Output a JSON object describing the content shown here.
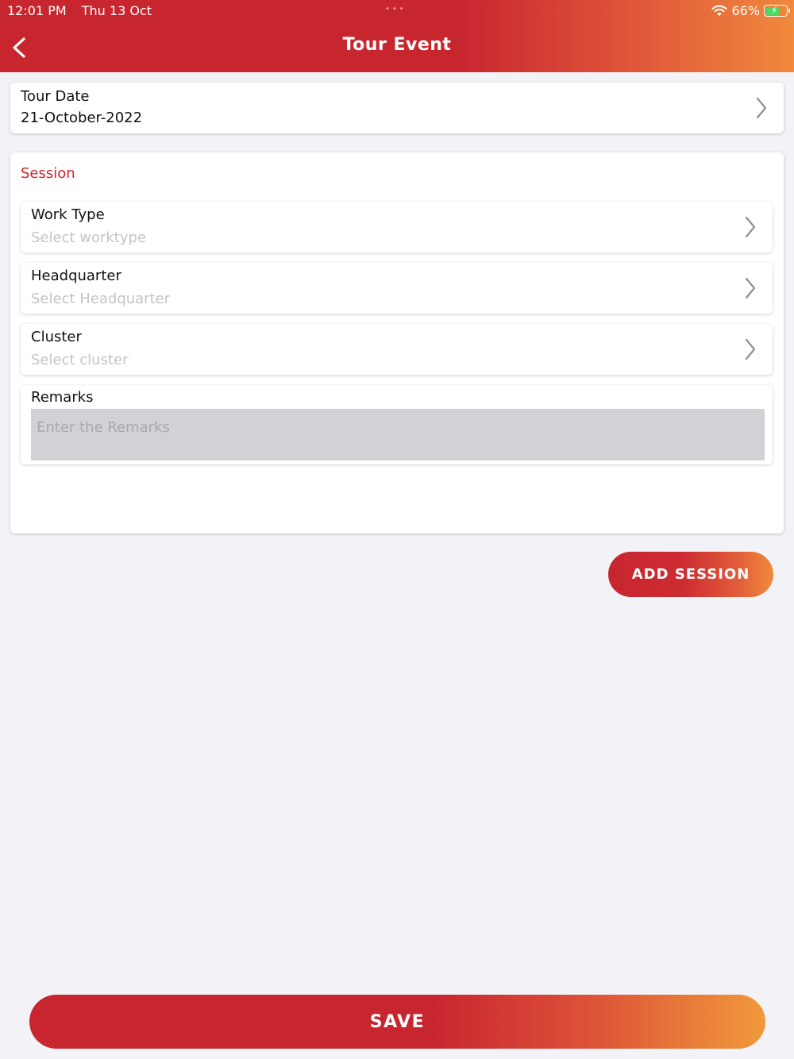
{
  "status_bar": {
    "time": "12:01 PM",
    "date": "Thu 13 Oct",
    "dots": "•••",
    "battery_percent": "66%",
    "wifi_icon": "wifi-icon",
    "battery_icon": "battery-charging-icon",
    "battery_level": 0.66
  },
  "header": {
    "title": "Tour Event",
    "back_icon": "chevron-left-icon"
  },
  "tour_date": {
    "label": "Tour Date",
    "value": "21-October-2022"
  },
  "session": {
    "title": "Session",
    "work_type": {
      "label": "Work Type",
      "placeholder": "Select worktype"
    },
    "headquarter": {
      "label": "Headquarter",
      "placeholder": "Select Headquarter"
    },
    "cluster": {
      "label": "Cluster",
      "placeholder": "Select cluster"
    },
    "remarks": {
      "label": "Remarks",
      "placeholder": "Enter the Remarks"
    }
  },
  "buttons": {
    "add_session": "ADD SESSION",
    "save": "SAVE"
  },
  "colors": {
    "brand_red": "#c8262f",
    "brand_orange": "#f0893c",
    "background": "#f2f2f7",
    "placeholder": "#c4c4c8"
  }
}
